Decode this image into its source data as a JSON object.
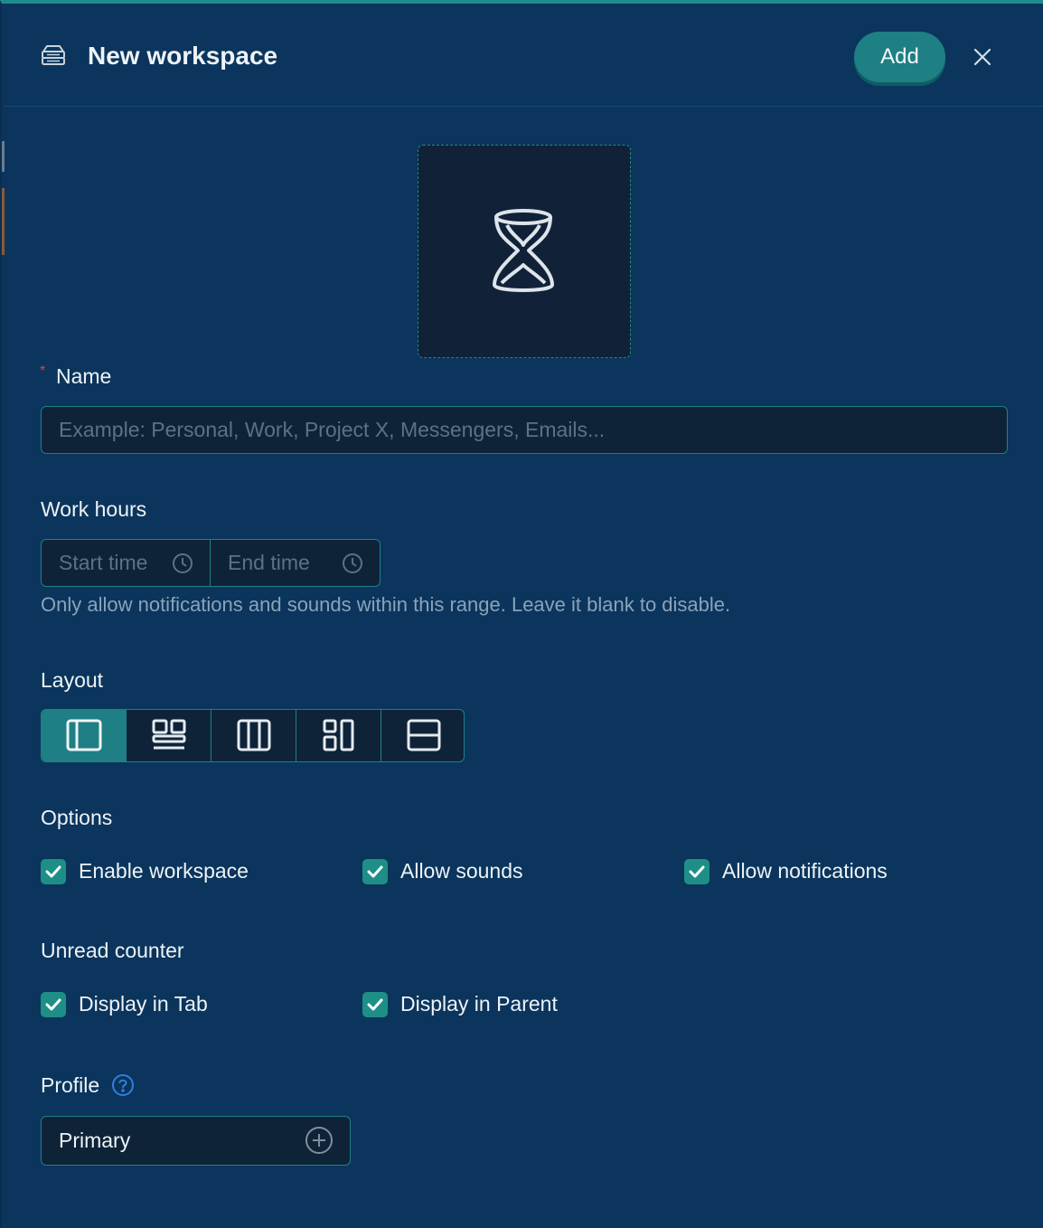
{
  "header": {
    "title": "New workspace",
    "add_label": "Add",
    "icon": "workspace-stack-icon",
    "close_icon": "close-icon"
  },
  "workspace_icon": {
    "name": "hourglass-icon"
  },
  "name_field": {
    "label": "Name",
    "required_mark": "*",
    "value": "",
    "placeholder": "Example: Personal, Work, Project X, Messengers, Emails..."
  },
  "work_hours": {
    "label": "Work hours",
    "start_placeholder": "Start time",
    "end_placeholder": "End time",
    "help": "Only allow notifications and sounds within this range. Leave it blank to disable."
  },
  "layout": {
    "label": "Layout",
    "options": [
      {
        "name": "sidebar-layout-icon",
        "selected": true
      },
      {
        "name": "grid-layout-icon",
        "selected": false
      },
      {
        "name": "columns-layout-icon",
        "selected": false
      },
      {
        "name": "masonry-layout-icon",
        "selected": false
      },
      {
        "name": "rows-layout-icon",
        "selected": false
      }
    ]
  },
  "options": {
    "label": "Options",
    "items": [
      {
        "label": "Enable workspace",
        "checked": true
      },
      {
        "label": "Allow sounds",
        "checked": true
      },
      {
        "label": "Allow notifications",
        "checked": true
      }
    ]
  },
  "unread_counter": {
    "label": "Unread counter",
    "items": [
      {
        "label": "Display in Tab",
        "checked": true
      },
      {
        "label": "Display in Parent",
        "checked": true
      }
    ]
  },
  "profile": {
    "label": "Profile",
    "help_icon": "question-circle-icon",
    "selected": "Primary",
    "add_icon": "plus-circle-icon"
  },
  "colors": {
    "background": "#0b355c",
    "accent": "#1e7f84",
    "checkbox": "#1e8f87",
    "input_bg": "#0f2338",
    "required": "#e0433f",
    "help_blue": "#2f7fe0"
  }
}
